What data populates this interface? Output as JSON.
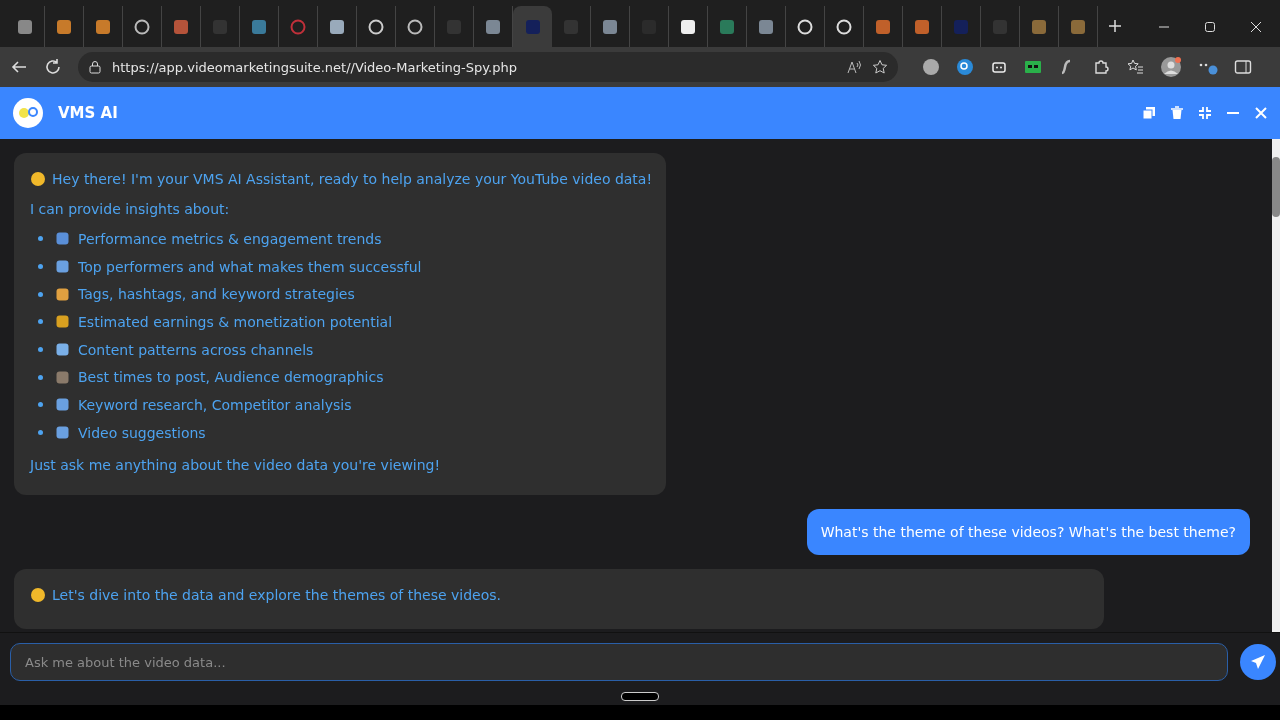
{
  "browser": {
    "tabs": [
      {
        "kind": "doc",
        "selected": false
      },
      {
        "kind": "link",
        "selected": false
      },
      {
        "kind": "link",
        "selected": false
      },
      {
        "kind": "globe",
        "selected": false
      },
      {
        "kind": "flow",
        "selected": false
      },
      {
        "kind": "dark",
        "selected": false
      },
      {
        "kind": "slash",
        "selected": false
      },
      {
        "kind": "ring",
        "selected": false
      },
      {
        "kind": "share",
        "selected": false
      },
      {
        "kind": "face",
        "selected": false
      },
      {
        "kind": "globe",
        "selected": false
      },
      {
        "kind": "dark",
        "selected": false
      },
      {
        "kind": "grey",
        "selected": false
      },
      {
        "kind": "navy",
        "selected": true
      },
      {
        "kind": "dark",
        "selected": false
      },
      {
        "kind": "grey",
        "selected": false
      },
      {
        "kind": "blank",
        "selected": false
      },
      {
        "kind": "notion",
        "selected": false
      },
      {
        "kind": "green",
        "selected": false
      },
      {
        "kind": "grey",
        "selected": false
      },
      {
        "kind": "github",
        "selected": false
      },
      {
        "kind": "github",
        "selected": false
      },
      {
        "kind": "orange",
        "selected": false
      },
      {
        "kind": "orange",
        "selected": false
      },
      {
        "kind": "navy",
        "selected": false
      },
      {
        "kind": "dark",
        "selected": false
      },
      {
        "kind": "brown",
        "selected": false
      },
      {
        "kind": "brown",
        "selected": false
      }
    ],
    "url": "https://app.videomarketingsuite.net//Video-Marketing-Spy.php"
  },
  "chat": {
    "title": "VMS AI",
    "messages": [
      {
        "kind": "assistant",
        "greeting": "Hey there! I'm your VMS AI Assistant, ready to help analyze your YouTube video data!",
        "intro": "I can provide insights about:",
        "items": [
          {
            "kind": "chart",
            "text": "Performance metrics & engagement trends"
          },
          {
            "kind": "search",
            "text": "Top performers and what makes them successful"
          },
          {
            "kind": "tag",
            "text": "Tags, hashtags, and keyword strategies"
          },
          {
            "kind": "money",
            "text": "Estimated earnings & monetization potential"
          },
          {
            "kind": "magnifier",
            "text": "Content patterns across channels"
          },
          {
            "kind": "people",
            "text": "Best times to post, Audience demographics"
          },
          {
            "kind": "search",
            "text": "Keyword research, Competitor analysis"
          },
          {
            "kind": "search",
            "text": "Video suggestions"
          }
        ],
        "closing": "Just ask me anything about the video data you're viewing!"
      },
      {
        "kind": "user",
        "text": "What's the theme of these videos? What's the best theme?"
      },
      {
        "kind": "assistant",
        "greeting": "Let's dive into the data and explore the themes of these videos."
      }
    ],
    "input": {
      "placeholder": "Ask me about the video data..."
    }
  }
}
